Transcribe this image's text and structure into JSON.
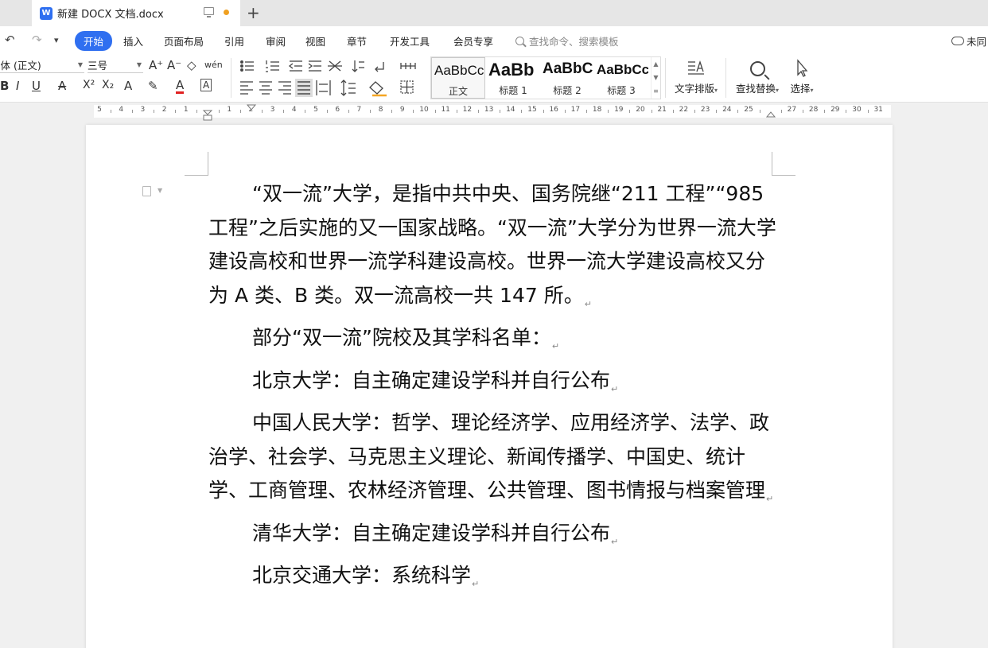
{
  "tab": {
    "title": "新建 DOCX 文档.docx",
    "logo_letter": "W",
    "new_tab_symbol": "+"
  },
  "quick_access": {
    "undo": "↶",
    "redo": "↷",
    "more": "▾"
  },
  "menu": {
    "items": [
      "开始",
      "插入",
      "页面布局",
      "引用",
      "审阅",
      "视图",
      "章节",
      "开发工具",
      "会员专享"
    ],
    "active": "开始",
    "search_placeholder": "查找命令、搜索模板",
    "cloud_status": "未同"
  },
  "ribbon": {
    "font_name": "宋体 (正文)",
    "font_size": "三号",
    "grow_font": "A⁺",
    "shrink_font": "A⁻",
    "clear_format": "◇",
    "pinyin": "wén",
    "bold": "B",
    "italic": "I",
    "underline": "U",
    "strike": "A",
    "superscript": "X²",
    "subscript": "X₂",
    "text_effect": "A",
    "highlight": "✎",
    "font_color": "A",
    "char_border": "A",
    "styles": [
      {
        "sample": "AaBbCcDd",
        "name": "正文"
      },
      {
        "sample": "AaBb",
        "name": "标题 1"
      },
      {
        "sample": "AaBbC",
        "name": "标题 2"
      },
      {
        "sample": "AaBbCcD",
        "name": "标题 3"
      }
    ],
    "text_layout_label": "文字排版",
    "find_replace_label": "查找替换",
    "select_label": "选择"
  },
  "ruler": {
    "labels": [
      "5",
      "4",
      "3",
      "2",
      "1",
      "",
      "1",
      "2",
      "3",
      "4",
      "5",
      "6",
      "7",
      "8",
      "9",
      "10",
      "11",
      "12",
      "13",
      "14",
      "15",
      "16",
      "17",
      "18",
      "19",
      "20",
      "21",
      "22",
      "23",
      "24",
      "25",
      "",
      "27",
      "28",
      "29",
      "30",
      "31"
    ]
  },
  "document": {
    "paragraphs": [
      {
        "text": "“双一流”大学，是指中共中央、国务院继“211 工程”“985 工程”之后实施的又一国家战略。“双一流”大学分为世界一流大学建设高校和世界一流学科建设高校。世界一流大学建设高校又分为 A 类、B 类。双一流高校一共 147 所。"
      },
      {
        "text": "部分“双一流”院校及其学科名单："
      },
      {
        "text": "北京大学：自主确定建设学科并自行公布"
      },
      {
        "text": "中国人民大学：哲学、理论经济学、应用经济学、法学、政治学、社会学、马克思主义理论、新闻传播学、中国史、统计学、工商管理、农林经济管理、公共管理、图书情报与档案管理"
      },
      {
        "text": "清华大学：自主确定建设学科并自行公布"
      },
      {
        "text": "北京交通大学：系统科学"
      }
    ],
    "return_mark": "↵"
  },
  "colors": {
    "accent": "#2f6ff0",
    "modified_dot": "#f0a020"
  }
}
